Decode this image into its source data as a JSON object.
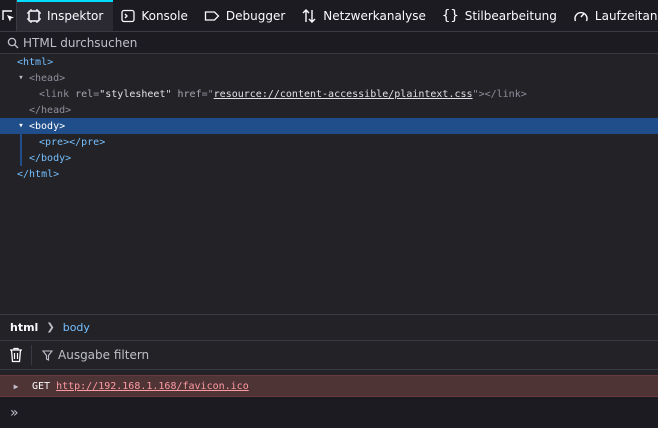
{
  "toolbar": {
    "tabs": [
      {
        "label": "Inspektor",
        "icon": "inspector-icon",
        "active": true
      },
      {
        "label": "Konsole",
        "icon": "console-icon"
      },
      {
        "label": "Debugger",
        "icon": "debugger-icon"
      },
      {
        "label": "Netzwerkanalyse",
        "icon": "network-icon"
      },
      {
        "label": "Stilbearbeitung",
        "icon": "style-editor-icon"
      },
      {
        "label": "Laufzeitanalyse",
        "icon": "performance-icon"
      }
    ]
  },
  "search": {
    "placeholder": "HTML durchsuchen"
  },
  "markup": {
    "html_open": "<html>",
    "head_open": "<head>",
    "link_tag_open": "<link",
    "link_rel_attr": "rel",
    "link_rel_val": "\"stylesheet\"",
    "link_href_attr": "href",
    "link_href_q1": "=\"",
    "link_href_val": "resource://content-accessible/plaintext.css",
    "link_href_q2": "\"",
    "link_tag_close": "></link>",
    "head_close": "</head>",
    "body_open": "<body>",
    "pre": "<pre></pre>",
    "body_close": "</body>",
    "html_close": "</html>"
  },
  "breadcrumbs": [
    "html",
    "body"
  ],
  "console": {
    "filter_placeholder": "Ausgabe filtern",
    "message": {
      "method": "GET",
      "url": "http://192.168.1.168/favicon.ico"
    },
    "prompt": "»"
  },
  "colors": {
    "accent": "#00ddff",
    "selection": "#204e8a",
    "tag": "#75bfff",
    "error_bg": "#4f3436"
  }
}
